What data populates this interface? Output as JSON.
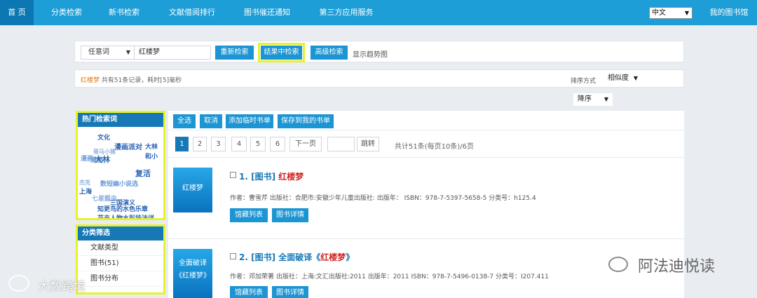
{
  "nav": {
    "items": [
      {
        "label": "首 页",
        "active": true
      },
      {
        "label": "分类检索"
      },
      {
        "label": "新书检索"
      },
      {
        "label": "文献借阅排行"
      },
      {
        "label": "图书催还通知"
      },
      {
        "label": "第三方应用服务"
      }
    ],
    "language": "中文",
    "my_library": "我的图书馆"
  },
  "search": {
    "field": "任意词",
    "query": "红楼梦",
    "research_label": "重新检索",
    "within_label": "结果中检索",
    "advanced_label": "高级检索",
    "trend_label": "显示趋势图"
  },
  "results_info": {
    "keyword": "红楼梦",
    "summary": "共有51条记录，耗时[5]毫秒",
    "sort_label": "排序方式",
    "sort_value": "相似度",
    "order_value": "降序"
  },
  "hot_words": {
    "title": "热门检索词",
    "tags": [
      "文化",
      "漫画派对",
      "大林",
      "漫画",
      "哥马小猪",
      "和小",
      "漫画",
      "大林",
      "复活",
      "杰克",
      "数短幽小说选",
      "上海",
      "七星瓢虫",
      "三国演义",
      "知更鸟的水色乐章",
      "花卉人物水彩技法详"
    ]
  },
  "category": {
    "title": "分类筛选",
    "items": [
      "文献类型",
      "图书(51)",
      "图书分布"
    ]
  },
  "toolbar": {
    "select_all": "全选",
    "cancel": "取消",
    "add_temp": "添加临时书单",
    "save_my": "保存到我的书单"
  },
  "pagination": {
    "pages": [
      "1",
      "2",
      "3",
      "4",
      "5",
      "6"
    ],
    "next": "下一页",
    "jump": "跳转",
    "summary": "共计51条(每页10条)/6页"
  },
  "records": [
    {
      "cover_lines": [
        "红楼梦"
      ],
      "index": "1.",
      "type": "[图书]",
      "title_prefix": "",
      "title_red": "红楼梦",
      "title_suffix": "",
      "meta": "作者：曹雪芹 出版社：合肥市:安徽少年儿童出版社: 出版年： ISBN：978-7-5397-5658-5 分类号：h125.4",
      "btn_holdings": "馆藏列表",
      "btn_detail": "图书详情"
    },
    {
      "cover_lines": [
        "全面破译",
        "《红楼梦》"
      ],
      "index": "2.",
      "type": "[图书]",
      "title_prefix": "全面破译《",
      "title_red": "红楼梦",
      "title_suffix": "》",
      "meta": "作者：邓加荣著 出版社：上海:文汇出版社:2011 出版年：2011 ISBN：978-7-5496-0138-7 分类号：I207.411",
      "btn_holdings": "馆藏列表",
      "btn_detail": "图书详情"
    }
  ],
  "watermarks": {
    "left": "大数跨境",
    "right": "阿法迪悦读"
  }
}
